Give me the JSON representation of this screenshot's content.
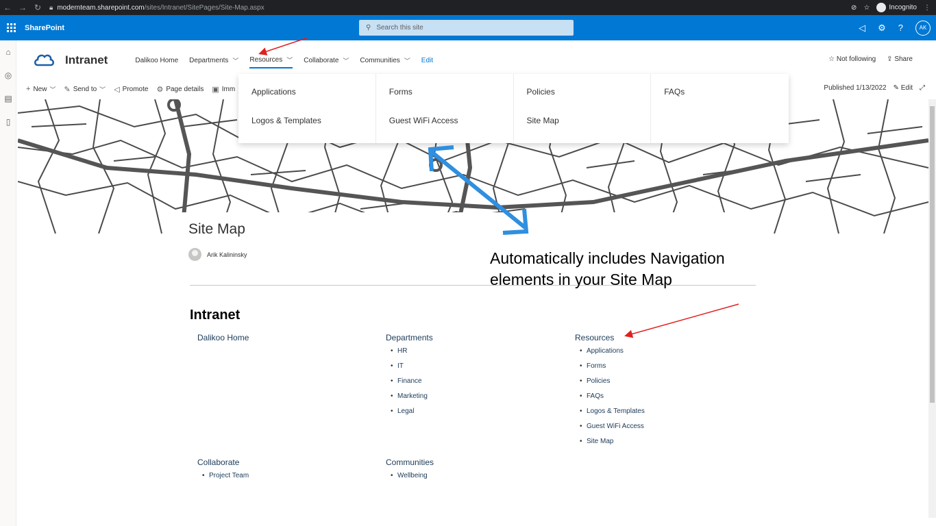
{
  "browser": {
    "url_host": "modernteam.sharepoint.com",
    "url_path": "/sites/Intranet/SitePages/Site-Map.aspx",
    "profile_label": "Incognito"
  },
  "suite": {
    "app_name": "SharePoint",
    "search_placeholder": "Search this site",
    "user_initials": "AK"
  },
  "site": {
    "title": "Intranet",
    "nav": [
      "Dalikoo Home",
      "Departments",
      "Resources",
      "Collaborate",
      "Communities",
      "Edit"
    ],
    "follow_label": "Not following",
    "share_label": "Share"
  },
  "commands": {
    "new": "New",
    "send_to": "Send to",
    "promote": "Promote",
    "page_details": "Page details",
    "immersive_truncated": "Imm",
    "published": "Published 1/13/2022",
    "edit": "Edit"
  },
  "mega_menu": {
    "col1": [
      "Applications",
      "Logos & Templates"
    ],
    "col2": [
      "Forms",
      "Guest WiFi Access"
    ],
    "col3": [
      "Policies",
      "Site Map"
    ],
    "col4": [
      "FAQs"
    ]
  },
  "page": {
    "title": "Site Map",
    "author": "Arik Kalininsky"
  },
  "annotation": {
    "text": "Automatically includes Navigation elements in your Site Map"
  },
  "sitemap": {
    "heading": "Intranet",
    "dalikoo_home": "Dalikoo Home",
    "departments": {
      "title": "Departments",
      "items": [
        "HR",
        "IT",
        "Finance",
        "Marketing",
        "Legal"
      ]
    },
    "resources": {
      "title": "Resources",
      "items": [
        "Applications",
        "Forms",
        "Policies",
        "FAQs",
        "Logos & Templates",
        "Guest WiFi Access",
        "Site Map"
      ]
    },
    "collaborate": {
      "title": "Collaborate",
      "items": [
        "Project Team"
      ]
    },
    "communities": {
      "title": "Communities",
      "items": [
        "Wellbeing"
      ]
    }
  },
  "colors": {
    "suite_blue": "#0078d4",
    "annotation_red": "#e02020",
    "annotation_blue": "#2f8fe0",
    "link_navy": "#1b3a57"
  }
}
